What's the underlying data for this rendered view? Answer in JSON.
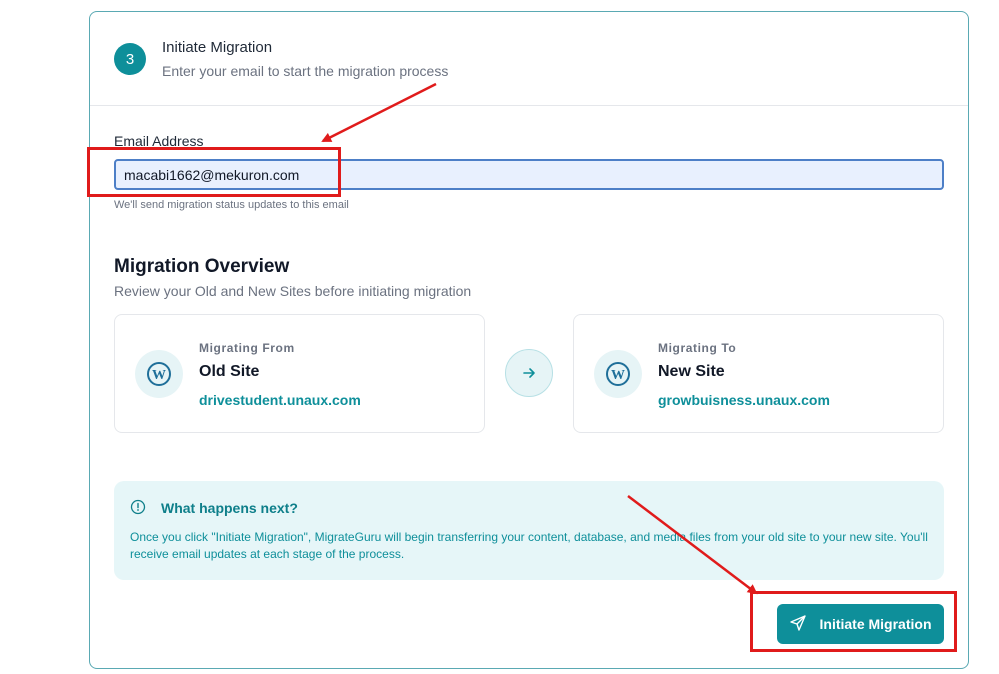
{
  "step": {
    "number": "3",
    "title": "Initiate Migration",
    "subtitle": "Enter your email to start the migration process"
  },
  "email": {
    "label": "Email Address",
    "value": "macabi1662@mekuron.com",
    "hint": "We'll send migration status updates to this email"
  },
  "overview": {
    "title": "Migration Overview",
    "subtitle": "Review your Old and New Sites before initiating migration",
    "from": {
      "kicker": "Migrating From",
      "name": "Old Site",
      "url": "drivestudent.unaux.com",
      "icon": "wordpress-icon"
    },
    "to": {
      "kicker": "Migrating To",
      "name": "New Site",
      "url": "growbuisness.unaux.com",
      "icon": "wordpress-icon"
    },
    "arrow_icon": "arrow-right-icon"
  },
  "info": {
    "icon": "info-icon",
    "title": "What happens next?",
    "body": "Once you click \"Initiate Migration\", MigrateGuru will begin transferring your content, database, and media files from your old site to your new site. You'll receive email updates at each stage of the process."
  },
  "button": {
    "label": "Initiate Migration",
    "icon": "send-icon"
  },
  "colors": {
    "accent": "#0e8f9a",
    "annotation": "#e01b1b"
  }
}
